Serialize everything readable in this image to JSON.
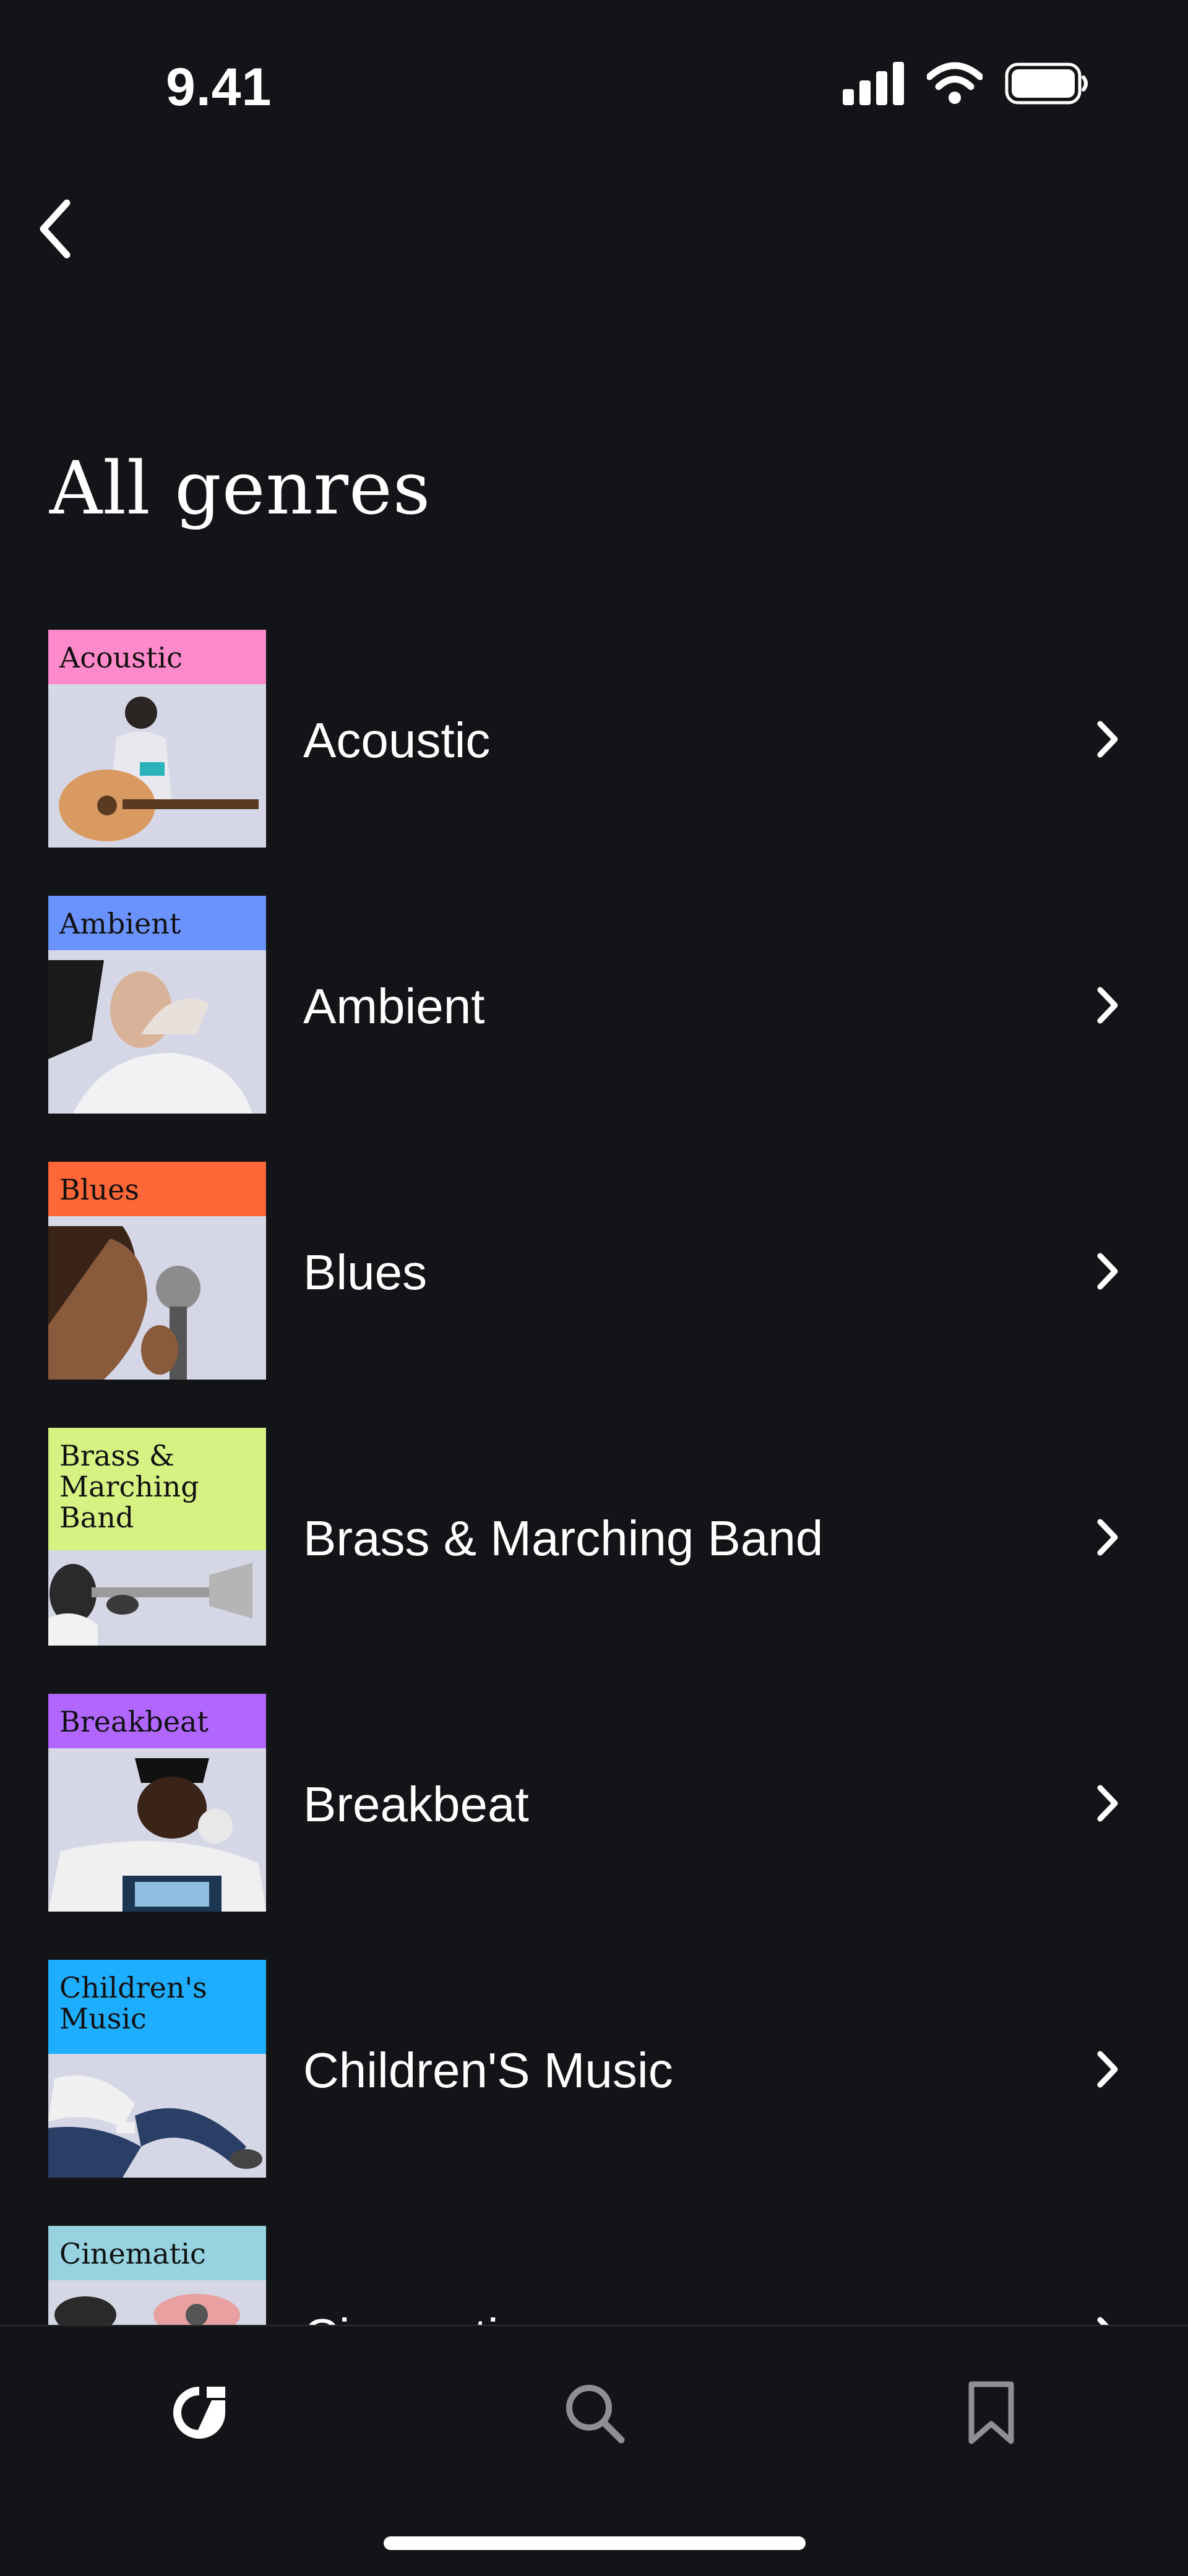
{
  "status_bar": {
    "time": "9.41"
  },
  "header": {
    "title": "All genres"
  },
  "genres": [
    {
      "thumb_label": "Acoustic",
      "name": "Acoustic",
      "color": "#FF8ACB"
    },
    {
      "thumb_label": "Ambient",
      "name": "Ambient",
      "color": "#6B93FF"
    },
    {
      "thumb_label": "Blues",
      "name": "Blues",
      "color": "#FF6638"
    },
    {
      "thumb_label": "Brass & Marching Band",
      "name": "Brass & Marching Band",
      "color": "#D6F283"
    },
    {
      "thumb_label": "Breakbeat",
      "name": "Breakbeat",
      "color": "#B066FF"
    },
    {
      "thumb_label": "Children's Music",
      "name": "Children'S Music",
      "color": "#1EAEFF"
    },
    {
      "thumb_label": "Cinematic",
      "name": "Cinematic",
      "color": "#96D2E0"
    }
  ],
  "tab_bar": {
    "icons": [
      "home-icon",
      "search-icon",
      "bookmark-icon"
    ]
  }
}
